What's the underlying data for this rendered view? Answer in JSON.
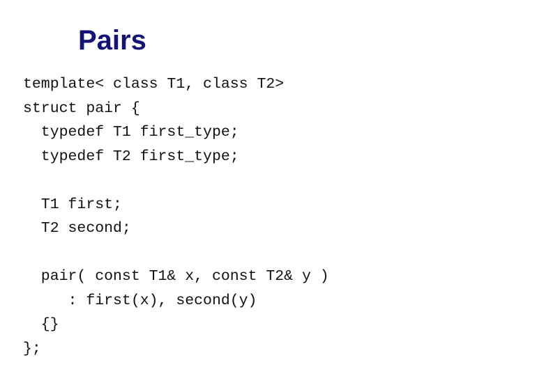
{
  "slide": {
    "title": "Pairs",
    "title_color": "#141478",
    "code_lines": [
      "template< class T1, class T2>",
      "struct pair {",
      "  typedef T1 first_type;",
      "  typedef T2 first_type;",
      "",
      "  T1 first;",
      "  T2 second;",
      "",
      "  pair( const T1& x, const T2& y )",
      "     : first(x), second(y)",
      "  {}",
      "};"
    ]
  }
}
